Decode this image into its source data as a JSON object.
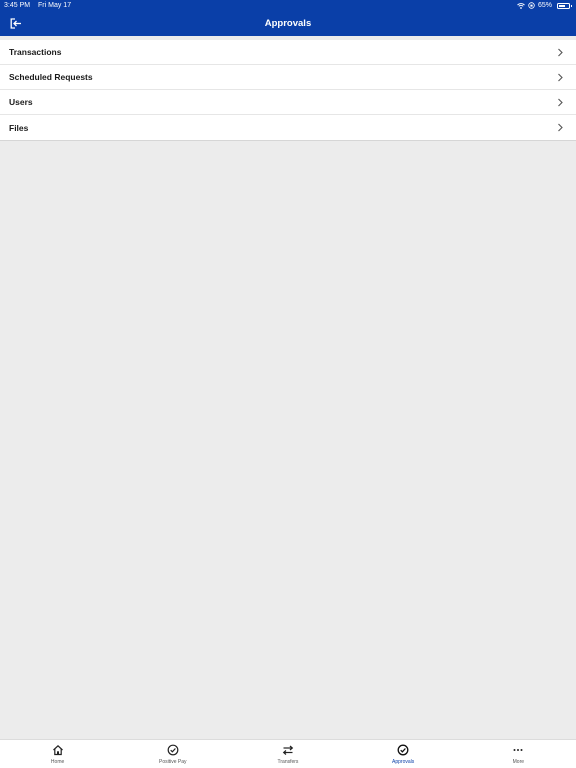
{
  "status_bar": {
    "time": "3:45 PM",
    "date": "Fri May 17",
    "battery": "65%",
    "battery_level": 0.65
  },
  "nav": {
    "title": "Approvals",
    "left_icon": "logout-icon"
  },
  "menu": {
    "items": [
      {
        "label": "Transactions"
      },
      {
        "label": "Scheduled Requests"
      },
      {
        "label": "Users"
      },
      {
        "label": "Files"
      }
    ]
  },
  "tabs": [
    {
      "label": "Home",
      "icon": "home-icon",
      "active": false
    },
    {
      "label": "Positive Pay",
      "icon": "badge-check-icon",
      "active": false
    },
    {
      "label": "Transfers",
      "icon": "transfer-arrows-icon",
      "active": false
    },
    {
      "label": "Approvals",
      "icon": "check-circle-icon",
      "active": true
    },
    {
      "label": "More",
      "icon": "more-dots-icon",
      "active": false
    }
  ],
  "colors": {
    "header_bg": "#0a3fa8",
    "active_tab": "#0a3fa8",
    "page_bg": "#ececec"
  }
}
